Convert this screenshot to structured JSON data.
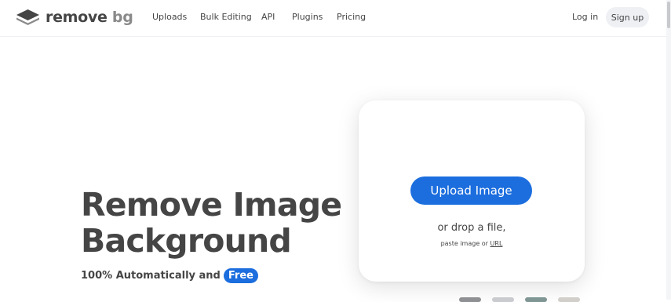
{
  "brand": {
    "name_part1": "remove",
    "name_part2": "bg",
    "logo_icon": "layers-logo-icon"
  },
  "nav": {
    "items": [
      {
        "label": "Uploads"
      },
      {
        "label": "Bulk Editing"
      },
      {
        "label": "API"
      },
      {
        "label": "Plugins"
      },
      {
        "label": "Pricing"
      }
    ],
    "login_label": "Log in",
    "signup_label": "Sign up"
  },
  "hero": {
    "title_line1": "Remove Image",
    "title_line2": "Background",
    "subtitle": "100% Automatically and",
    "badge": "Free"
  },
  "upload": {
    "button_label": "Upload Image",
    "drop_text": "or drop a file,",
    "paste_prefix": "paste image or",
    "url_link": "URL"
  },
  "colors": {
    "accent": "#1c6ede",
    "text": "#454545",
    "signup_bg": "#eef0f4"
  }
}
